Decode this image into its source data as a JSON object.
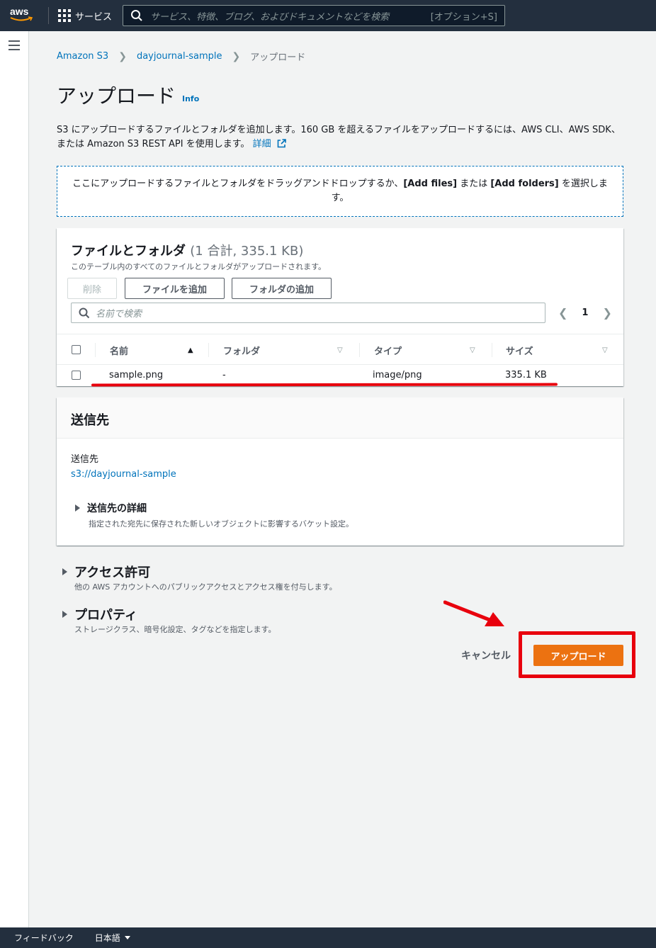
{
  "nav": {
    "logo_text": "aws",
    "services_label": "サービス",
    "search_placeholder": "サービス、特徴、ブログ、およびドキュメントなどを検索",
    "search_shortcut": "[オプション+S]"
  },
  "breadcrumb": {
    "items": [
      "Amazon S3",
      "dayjournal-sample"
    ],
    "current": "アップロード"
  },
  "page": {
    "title": "アップロード",
    "info_label": "Info",
    "description": "S3 にアップロードするファイルとフォルダを追加します。160 GB を超えるファイルをアップロードするには、AWS CLI、AWS SDK、または Amazon S3 REST API を使用します。",
    "description_link": "詳細"
  },
  "dropzone": {
    "text_before": "ここにアップロードするファイルとフォルダをドラッグアンドドロップするか、",
    "add_files": "[Add files]",
    "text_middle": " または ",
    "add_folders": "[Add folders]",
    "text_after": " を選択します。"
  },
  "files_panel": {
    "title": "ファイルとフォルダ",
    "count": "(1 合計, 335.1 KB)",
    "subtitle": "このテーブル内のすべてのファイルとフォルダがアップロードされます。",
    "delete_label": "削除",
    "add_files_label": "ファイルを追加",
    "add_folder_label": "フォルダの追加",
    "search_placeholder": "名前で検索",
    "page_number": "1",
    "columns": [
      "名前",
      "フォルダ",
      "タイプ",
      "サイズ"
    ],
    "rows": [
      {
        "name": "sample.png",
        "folder": "-",
        "type": "image/png",
        "size": "335.1 KB"
      }
    ]
  },
  "destination": {
    "header": "送信先",
    "label": "送信先",
    "value": "s3://dayjournal-sample",
    "details_title": "送信先の詳細",
    "details_sub": "指定された宛先に保存された新しいオブジェクトに影響するバケット設定。"
  },
  "sections": {
    "access": {
      "title": "アクセス許可",
      "sub": "他の AWS アカウントへのパブリックアクセスとアクセス権を付与します。"
    },
    "properties": {
      "title": "プロパティ",
      "sub": "ストレージクラス、暗号化設定、タグなどを指定します。"
    }
  },
  "actions": {
    "cancel_label": "キャンセル",
    "upload_label": "アップロード"
  },
  "footer": {
    "feedback": "フィードバック",
    "language": "日本語"
  },
  "colors": {
    "nav_bg": "#232f3e",
    "link": "#0073bb",
    "primary_button": "#ec7211",
    "annotation_red": "#e8000d"
  },
  "icons": [
    "aws-logo-icon",
    "grid-icon",
    "search-icon",
    "hamburger-icon",
    "external-link-icon",
    "chevron-left-icon",
    "chevron-right-icon",
    "sort-icon",
    "caret-right-icon",
    "caret-down-icon"
  ]
}
